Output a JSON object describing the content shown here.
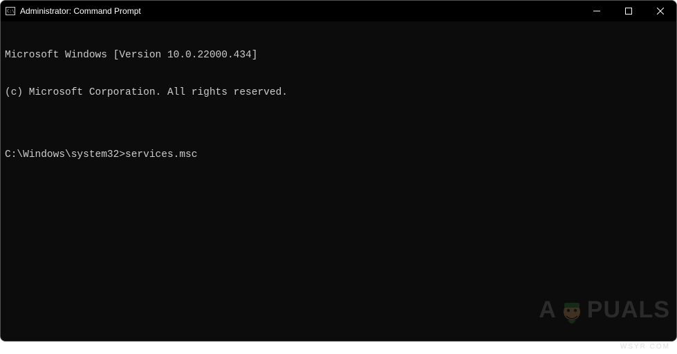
{
  "window": {
    "title": "Administrator: Command Prompt"
  },
  "terminal": {
    "line1": "Microsoft Windows [Version 10.0.22000.434]",
    "line2": "(c) Microsoft Corporation. All rights reserved.",
    "blank": "",
    "prompt": "C:\\Windows\\system32>",
    "command": "services.msc"
  },
  "watermark": {
    "text_left": "A",
    "text_right": "PUALS",
    "sub": "WSYR COM"
  }
}
